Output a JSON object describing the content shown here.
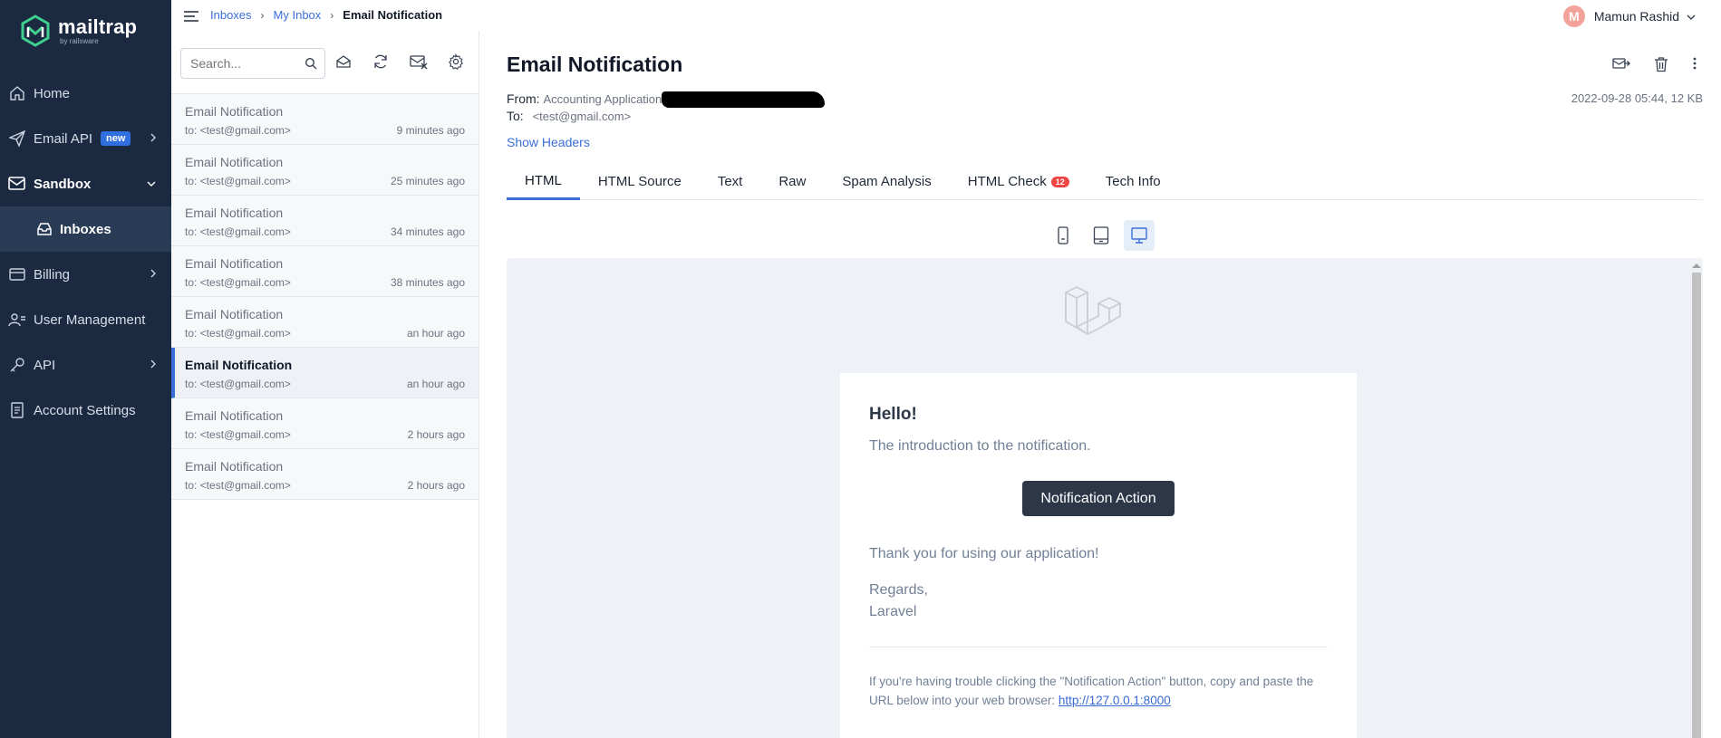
{
  "brand": {
    "name": "mailtrap",
    "sub": "by railsware"
  },
  "sidebar": {
    "items": [
      {
        "label": "Home"
      },
      {
        "label": "Email API",
        "badge": "new"
      },
      {
        "label": "Sandbox"
      },
      {
        "label": "Inboxes"
      },
      {
        "label": "Billing"
      },
      {
        "label": "User Management"
      },
      {
        "label": "API"
      },
      {
        "label": "Account Settings"
      }
    ]
  },
  "breadcrumb": {
    "items": [
      "Inboxes",
      "My Inbox",
      "Email Notification"
    ],
    "separator": "›"
  },
  "user": {
    "initial": "M",
    "name": "Mamun Rashid"
  },
  "search": {
    "placeholder": "Search..."
  },
  "messages": [
    {
      "subject": "Email Notification",
      "to": "to: <test@gmail.com>",
      "time": "9 minutes ago"
    },
    {
      "subject": "Email Notification",
      "to": "to: <test@gmail.com>",
      "time": "25 minutes ago"
    },
    {
      "subject": "Email Notification",
      "to": "to: <test@gmail.com>",
      "time": "34 minutes ago"
    },
    {
      "subject": "Email Notification",
      "to": "to: <test@gmail.com>",
      "time": "38 minutes ago"
    },
    {
      "subject": "Email Notification",
      "to": "to: <test@gmail.com>",
      "time": "an hour ago"
    },
    {
      "subject": "Email Notification",
      "to": "to: <test@gmail.com>",
      "time": "an hour ago",
      "active": true
    },
    {
      "subject": "Email Notification",
      "to": "to: <test@gmail.com>",
      "time": "2 hours ago"
    },
    {
      "subject": "Email Notification",
      "to": "to: <test@gmail.com>",
      "time": "2 hours ago"
    }
  ],
  "detail": {
    "title": "Email Notification",
    "from_label": "From:",
    "from_value": "Accounting Application",
    "to_label": "To:",
    "to_value": "<test@gmail.com>",
    "date_info": "2022-09-28 05:44, 12 KB",
    "show_headers": "Show Headers",
    "tabs": [
      {
        "label": "HTML",
        "active": true
      },
      {
        "label": "HTML Source"
      },
      {
        "label": "Text"
      },
      {
        "label": "Raw"
      },
      {
        "label": "Spam Analysis"
      },
      {
        "label": "HTML Check",
        "count": "12"
      },
      {
        "label": "Tech Info"
      }
    ]
  },
  "email": {
    "greeting": "Hello!",
    "intro": "The introduction to the notification.",
    "button": "Notification Action",
    "thanks": "Thank you for using our application!",
    "regards": "Regards,",
    "signature": "Laravel",
    "subcopy": "If you're having trouble clicking the \"Notification Action\" button, copy and paste the URL below into your web browser:",
    "url": "http://127.0.0.1:8000"
  },
  "colors": {
    "sidebar": "#1b2a41",
    "accent": "#3b6fd8",
    "badge": "#ef4444",
    "button": "#2d3748"
  }
}
